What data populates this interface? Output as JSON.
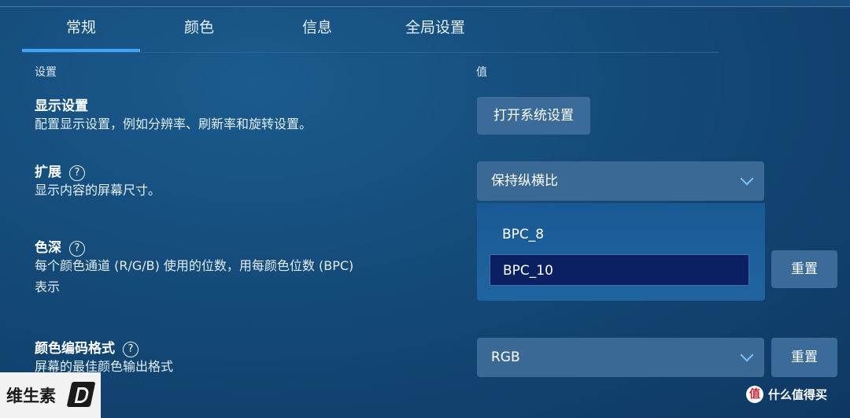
{
  "tabs": [
    {
      "label": "常规",
      "active": true
    },
    {
      "label": "颜色",
      "active": false
    },
    {
      "label": "信息",
      "active": false
    },
    {
      "label": "全局设置",
      "active": false
    }
  ],
  "columns": {
    "setting": "设置",
    "value": "值"
  },
  "display_settings": {
    "title": "显示设置",
    "description": "配置显示设置，例如分辨率、刷新率和旋转设置。",
    "button": "打开系统设置"
  },
  "scaling": {
    "title": "扩展",
    "help": "?",
    "description": "显示内容的屏幕尺寸。",
    "selected": "保持纵横比"
  },
  "color_depth": {
    "title": "色深",
    "help": "?",
    "description_line1": "每个颜色通道 (R/G/B) 使用的位数，用每颜色位数 (BPC)",
    "description_line2": "表示",
    "options": [
      "BPC_8",
      "BPC_10"
    ],
    "selected": "BPC_10",
    "reset": "重置"
  },
  "color_format": {
    "title": "颜色编码格式",
    "help": "?",
    "description": "屏幕的最佳颜色输出格式",
    "selected": "RGB",
    "reset": "重置"
  },
  "watermark_left": "维生素",
  "watermark_right": {
    "icon": "值",
    "text": "什么值得买"
  }
}
